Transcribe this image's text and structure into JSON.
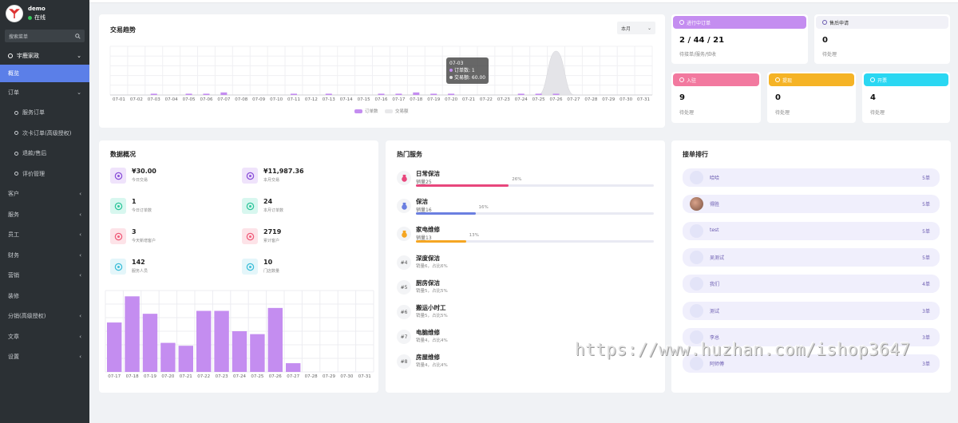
{
  "sidebar": {
    "username": "demo",
    "status": "在线",
    "search_placeholder": "搜索菜单",
    "shop": "宇鹿家政",
    "active": "概览",
    "order_group": "订单",
    "order_subitems": [
      "服务订单",
      "次卡订单(高级授权)",
      "退款/售后",
      "评价管理"
    ],
    "groups": [
      {
        "label": "客户",
        "arrow": true
      },
      {
        "label": "服务",
        "arrow": true
      },
      {
        "label": "员工",
        "arrow": true
      },
      {
        "label": "财务",
        "arrow": true
      },
      {
        "label": "营销",
        "arrow": true
      },
      {
        "label": "装修",
        "arrow": false
      },
      {
        "label": "分销(高级授权)",
        "arrow": true
      },
      {
        "label": "文章",
        "arrow": true
      },
      {
        "label": "设置",
        "arrow": true
      }
    ]
  },
  "trend": {
    "title": "交易趋势",
    "period": "本月",
    "legend": [
      "订单数",
      "交易额"
    ],
    "tooltip": {
      "date": "07-03",
      "orders_label": "订单数: 1",
      "amount_label": "交易额: 60.00"
    }
  },
  "stats": {
    "in_progress": {
      "label": "进行中订单",
      "value": "2 / 44 / 21",
      "sub": "待接单/服务/验收"
    },
    "after_sale": {
      "label": "售后申请",
      "value": "0",
      "sub": "待处理"
    },
    "join": {
      "label": "入驻",
      "value": "9",
      "sub": "待处理"
    },
    "withdraw": {
      "label": "提现",
      "value": "0",
      "sub": "待处理"
    },
    "invoice": {
      "label": "开票",
      "value": "4",
      "sub": "待处理"
    }
  },
  "overview": {
    "title": "数据概况",
    "items": [
      {
        "value": "¥30.00",
        "label": "今日交易",
        "icon": "currency-icon"
      },
      {
        "value": "¥11,987.36",
        "label": "本月交易",
        "icon": "currency-icon"
      },
      {
        "value": "1",
        "label": "今日订单数",
        "icon": "heart-icon"
      },
      {
        "value": "24",
        "label": "本月订单数",
        "icon": "heart-icon"
      },
      {
        "value": "3",
        "label": "今天新增客户",
        "icon": "user-icon"
      },
      {
        "value": "2719",
        "label": "累计客户",
        "icon": "user-icon"
      },
      {
        "value": "142",
        "label": "服务人员",
        "icon": "staff-icon"
      },
      {
        "value": "10",
        "label": "门店数量",
        "icon": "grid-icon"
      }
    ]
  },
  "hot": {
    "title": "热门服务",
    "top": [
      {
        "name": "日常保洁",
        "sales": "销量25",
        "pct": "26%",
        "icon": "trophy-icon",
        "color": "#e8467c"
      },
      {
        "name": "保洁",
        "sales": "销量16",
        "pct": "16%",
        "icon": "medal-icon",
        "color": "#6b7fe0"
      },
      {
        "name": "家电维修",
        "sales": "销量13",
        "pct": "13%",
        "icon": "medal-icon",
        "color": "#f5a623"
      }
    ],
    "rest": [
      {
        "rank": "#4",
        "name": "深度保洁",
        "sub": "销量6，占比6%"
      },
      {
        "rank": "#5",
        "name": "厨房保洁",
        "sub": "销量5，占比5%"
      },
      {
        "rank": "#6",
        "name": "搬运小时工",
        "sub": "销量5，占比5%"
      },
      {
        "rank": "#7",
        "name": "电脑维修",
        "sub": "销量4，占比4%"
      },
      {
        "rank": "#8",
        "name": "房屋维修",
        "sub": "销量4，占比4%"
      }
    ]
  },
  "ranking": {
    "title": "接单排行",
    "items": [
      {
        "name": "哈哈",
        "count": "5单"
      },
      {
        "name": "得胜",
        "count": "5单"
      },
      {
        "name": "test",
        "count": "5单"
      },
      {
        "name": "吴测试",
        "count": "5单"
      },
      {
        "name": "我们",
        "count": "4单"
      },
      {
        "name": "测试",
        "count": "3单"
      },
      {
        "name": "李总",
        "count": "3单"
      },
      {
        "name": "阿师傅",
        "count": "3单"
      }
    ]
  },
  "watermark": "https://www.huzhan.com/ishop3647",
  "chart_data": [
    {
      "type": "bar",
      "title": "交易趋势",
      "categories": [
        "07-01",
        "07-02",
        "07-03",
        "07-04",
        "07-05",
        "07-06",
        "07-07",
        "07-08",
        "07-09",
        "07-10",
        "07-11",
        "07-12",
        "07-13",
        "07-14",
        "07-15",
        "07-16",
        "07-17",
        "07-18",
        "07-19",
        "07-20",
        "07-21",
        "07-22",
        "07-23",
        "07-24",
        "07-25",
        "07-26",
        "07-27",
        "07-28",
        "07-29",
        "07-30",
        "07-31"
      ],
      "series": [
        {
          "name": "订单数",
          "values": [
            0,
            0,
            1,
            0,
            1,
            1,
            2,
            0,
            0,
            0,
            1,
            0,
            1,
            0,
            0,
            1,
            1,
            2,
            1,
            1,
            0,
            0,
            0,
            1,
            1,
            1,
            0,
            0,
            0,
            0,
            0
          ]
        },
        {
          "name": "交易额",
          "values": [
            0,
            0,
            60,
            0,
            0,
            0,
            0,
            0,
            0,
            0,
            0,
            0,
            0,
            0,
            0,
            0,
            0,
            0,
            0,
            0,
            0,
            0,
            0,
            0,
            60,
            11000,
            60,
            0,
            0,
            0,
            0
          ]
        }
      ],
      "legend": "bottom"
    },
    {
      "type": "bar",
      "categories": [
        "07-17",
        "07-18",
        "07-19",
        "07-20",
        "07-21",
        "07-22",
        "07-23",
        "07-24",
        "07-25",
        "07-26",
        "07-27",
        "07-28",
        "07-29",
        "07-30",
        "07-31"
      ],
      "values": [
        17,
        26,
        20,
        10,
        9,
        21,
        21,
        14,
        13,
        22,
        3,
        0,
        0,
        0,
        0
      ],
      "grid": true
    }
  ]
}
